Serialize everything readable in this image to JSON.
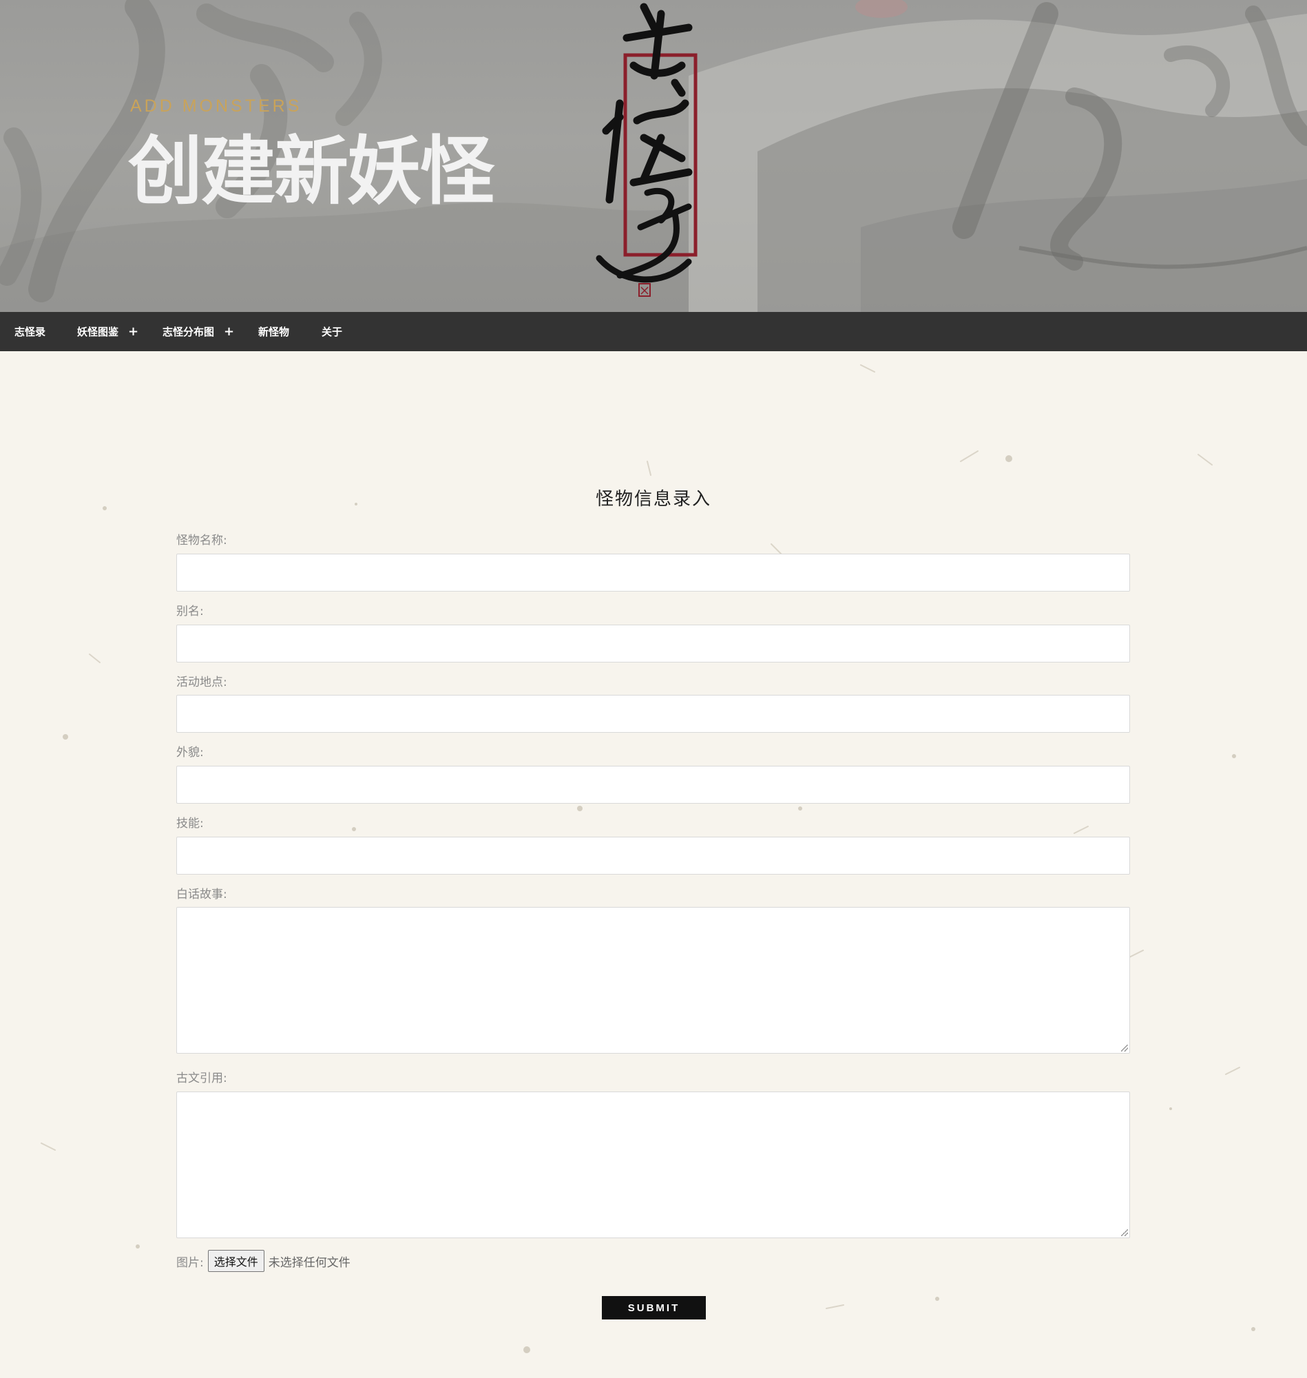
{
  "banner": {
    "subtitle": "ADD MONSTERS",
    "title": "创建新妖怪",
    "logo_text": "志怪录"
  },
  "nav": {
    "items": [
      {
        "label": "志怪录",
        "has_submenu": false
      },
      {
        "label": "妖怪图鉴",
        "has_submenu": true
      },
      {
        "label": "志怪分布图",
        "has_submenu": true
      },
      {
        "label": "新怪物",
        "has_submenu": false
      },
      {
        "label": "关于",
        "has_submenu": false
      }
    ],
    "submenu_icon": "+"
  },
  "form": {
    "title": "怪物信息录入",
    "fields": [
      {
        "label": "怪物名称:",
        "value": ""
      },
      {
        "label": "别名:",
        "value": ""
      },
      {
        "label": "活动地点:",
        "value": ""
      },
      {
        "label": "外貌:",
        "value": ""
      },
      {
        "label": "技能:",
        "value": ""
      },
      {
        "label": "白话故事:",
        "value": ""
      },
      {
        "label": "古文引用:",
        "value": ""
      }
    ],
    "file": {
      "label": "图片:",
      "button_label": "选择文件",
      "status": "未选择任何文件"
    },
    "submit_label": "SUBMIT"
  },
  "colors": {
    "nav_bg": "#333333",
    "subtitle_gold": "#c9a35a",
    "seal_red": "#8b1f2b",
    "submit_bg": "#111111",
    "paper": "#f7f4ed"
  }
}
